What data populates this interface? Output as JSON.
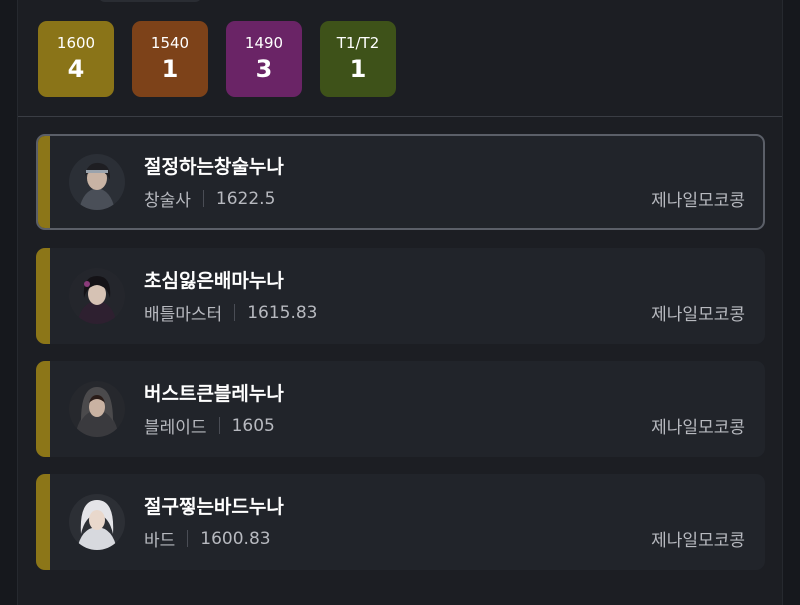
{
  "badges": [
    {
      "label": "1600",
      "count": "4",
      "color": "#8a7418"
    },
    {
      "label": "1540",
      "count": "1",
      "color": "#7d4219"
    },
    {
      "label": "1490",
      "count": "3",
      "color": "#6a2466"
    },
    {
      "label": "T1/T2",
      "count": "1",
      "color": "#3e5219"
    }
  ],
  "characters": [
    {
      "name": "절정하는창술누나",
      "class": "창술사",
      "item_level": "1622.5",
      "server": "제나일모코콩",
      "selected": true
    },
    {
      "name": "초심잃은배마누나",
      "class": "배틀마스터",
      "item_level": "1615.83",
      "server": "제나일모코콩",
      "selected": false
    },
    {
      "name": "버스트큰블레누나",
      "class": "블레이드",
      "item_level": "1605",
      "server": "제나일모코콩",
      "selected": false
    },
    {
      "name": "절구찧는바드누나",
      "class": "바드",
      "item_level": "1600.83",
      "server": "제나일모코콩",
      "selected": false
    }
  ],
  "colors": {
    "accent": "#8c7618",
    "card": "#21242a",
    "background": "#16181d"
  }
}
